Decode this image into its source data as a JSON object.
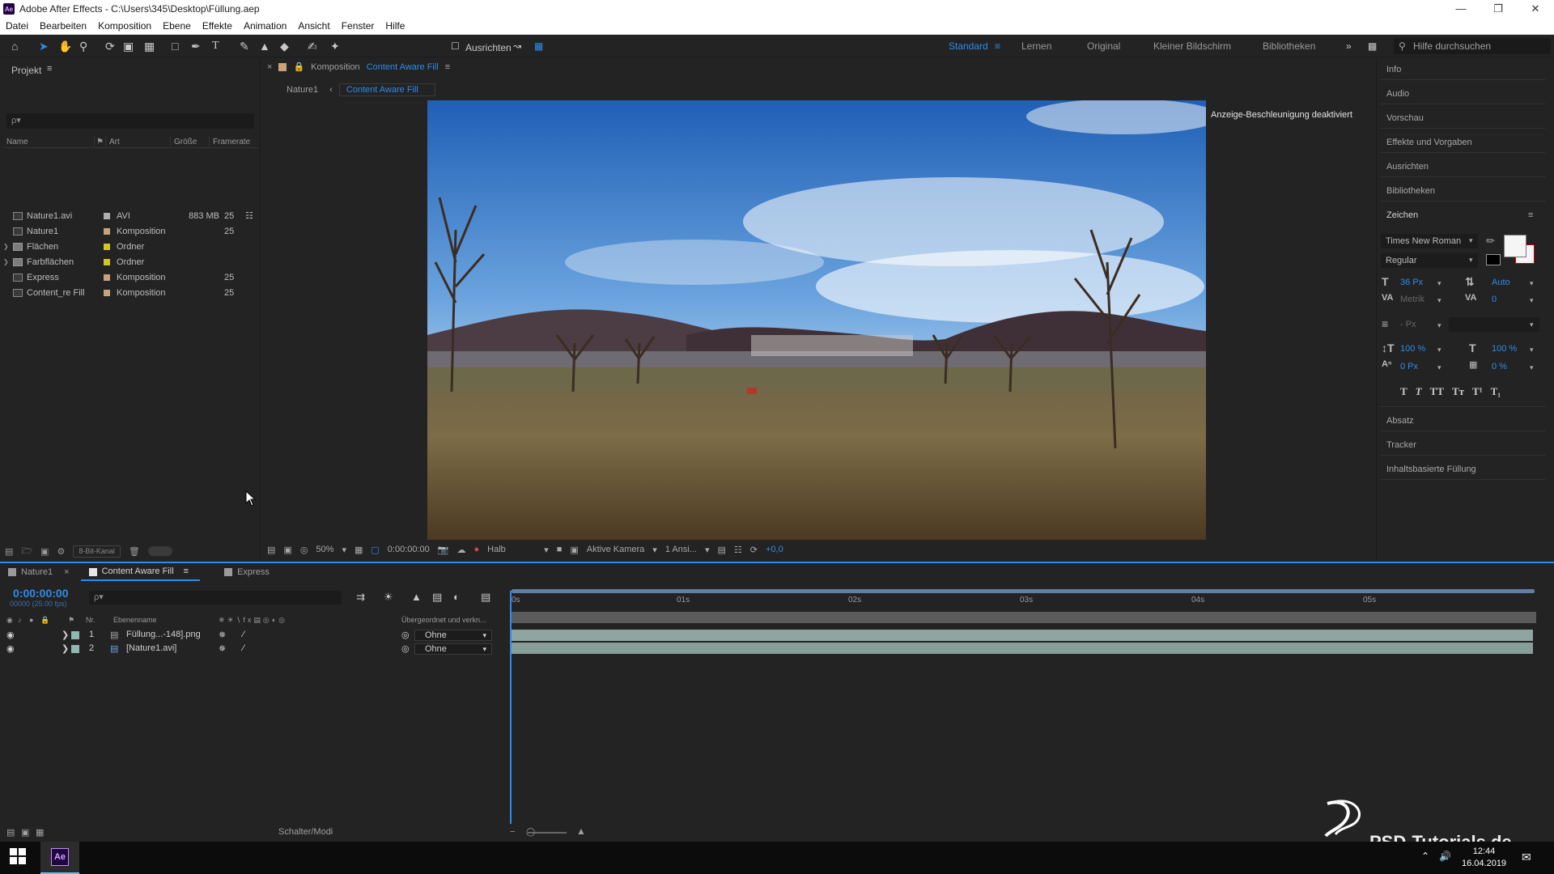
{
  "window": {
    "title": "Adobe After Effects - C:\\Users\\345\\Desktop\\Füllung.aep",
    "app_icon": "Ae"
  },
  "menu": [
    "Datei",
    "Bearbeiten",
    "Komposition",
    "Ebene",
    "Effekte",
    "Animation",
    "Ansicht",
    "Fenster",
    "Hilfe"
  ],
  "toolbar": {
    "align_label": "Ausrichten",
    "workspaces": [
      "Standard",
      "Lernen",
      "Original",
      "Kleiner Bildschirm",
      "Bibliotheken"
    ],
    "active_workspace": "Standard",
    "help_placeholder": "Hilfe durchsuchen"
  },
  "project": {
    "title": "Projekt",
    "search_placeholder": "ρ▾",
    "columns": [
      "Name",
      "Art",
      "Größe",
      "Framerate"
    ],
    "items": [
      {
        "name": "Nature1.avi",
        "type": "AVI",
        "size": "883 MB",
        "fps": "25",
        "folder": false,
        "label_color": "#b0b0b0"
      },
      {
        "name": "Nature1",
        "type": "Komposition",
        "size": "",
        "fps": "25",
        "folder": false,
        "label_color": "#c9a27a"
      },
      {
        "name": "Flächen",
        "type": "Ordner",
        "size": "",
        "fps": "",
        "folder": true,
        "label_color": "#d6c22b"
      },
      {
        "name": "Farbflächen",
        "type": "Ordner",
        "size": "",
        "fps": "",
        "folder": true,
        "label_color": "#d6c22b"
      },
      {
        "name": "Express",
        "type": "Komposition",
        "size": "",
        "fps": "25",
        "folder": false,
        "label_color": "#c9a27a"
      },
      {
        "name": "Content_re Fill",
        "type": "Komposition",
        "size": "",
        "fps": "25",
        "folder": false,
        "label_color": "#c9a27a"
      }
    ],
    "bit_depth": "8-Bit-Kanal"
  },
  "composition": {
    "tab_prefix": "Komposition",
    "tab_name": "Content Aware Fill",
    "breadcrumb_parent": "Nature1",
    "breadcrumb_current": "Content Aware Fill",
    "gpu_notice": "Anzeige-Beschleunigung deaktiviert",
    "zoom": "50%",
    "timecode": "0:00:00:00",
    "resolution": "Halb",
    "camera": "Aktive Kamera",
    "views": "1 Ansi...",
    "exposure": "+0,0"
  },
  "right_panel": {
    "sections": [
      "Info",
      "Audio",
      "Vorschau",
      "Effekte und Vorgaben",
      "Ausrichten",
      "Bibliotheken"
    ],
    "character_title": "Zeichen",
    "font": "Times New Roman",
    "style": "Regular",
    "font_size": "36 Px",
    "leading": "Auto",
    "kerning": "Metrik",
    "tracking": "0",
    "stroke_unit": "- Px",
    "vscale": "100 %",
    "hscale": "100 %",
    "baseline": "0 Px",
    "tsume": "0 %",
    "text_styles": [
      "T",
      "T",
      "TT",
      "Tт",
      "T¹",
      "T₁"
    ],
    "lower_sections": [
      "Absatz",
      "Tracker",
      "Inhaltsbasierte Füllung"
    ]
  },
  "timeline": {
    "tabs": [
      "Nature1",
      "Content Aware Fill",
      "Express"
    ],
    "active_tab": "Content Aware Fill",
    "timecode": "0:00:00:00",
    "fps_text": "00000 (25.00 fps)",
    "search_placeholder": "ρ▾",
    "col_nr": "Nr.",
    "col_name": "Ebenenname",
    "col_parent": "Übergeordnet und verkn...",
    "layers": [
      {
        "nr": "1",
        "name": "Füllung...-148].png",
        "parent": "Ohne"
      },
      {
        "nr": "2",
        "name": "[Nature1.avi]",
        "parent": "Ohne"
      }
    ],
    "ruler": [
      "0s",
      "01s",
      "02s",
      "03s",
      "04s",
      "05s"
    ],
    "switches_label": "Schalter/Modi"
  },
  "taskbar": {
    "time": "12:44",
    "date": "16.04.2019"
  },
  "watermark": "PSD-Tutorials.de"
}
